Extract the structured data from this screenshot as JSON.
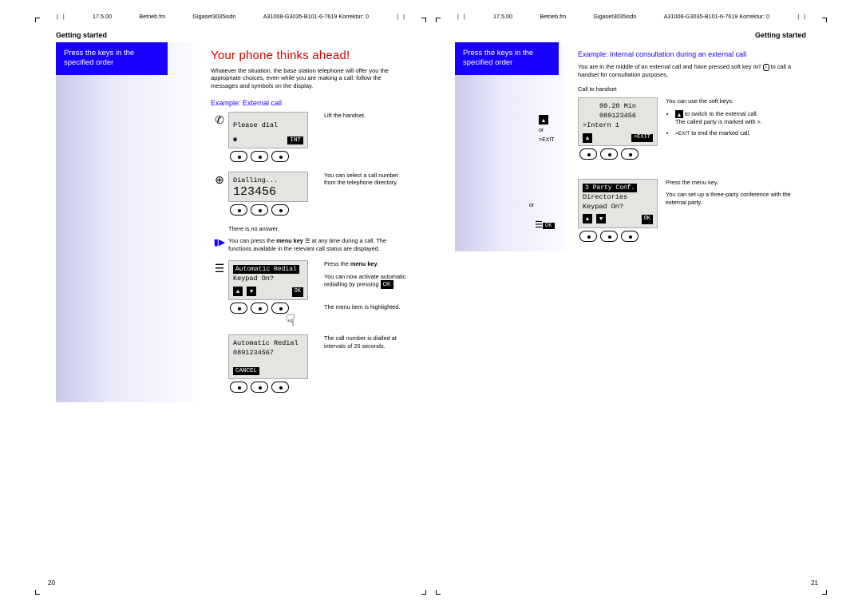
{
  "meta": {
    "left": {
      "a": "17.5.00",
      "b": "Betrieb.fm",
      "c": "Gigaset3035isdn",
      "d": "A31008-G3035-B101-6-7619  Korrektur: 0"
    },
    "right": {
      "a": "17.5.00",
      "b": "Betrieb.fm",
      "c": "Gigaset3035isdn",
      "d": "A31008-G3035-B101-6-7619  Korrektur: 0"
    }
  },
  "header": {
    "left": "Getting started",
    "right": "Getting started"
  },
  "blue_box": "Press the keys in the specified order",
  "pages": {
    "left_num": "20",
    "right_num": "21"
  },
  "left": {
    "h1": "Your phone thinks ahead!",
    "intro": "Whatever the situation, the base station telephone will offer you the appropriate choices, even while you are making a call: follow the messages and symbols on the display.",
    "ex_title": "Example: External call",
    "scr1_line": "Please dial",
    "scr1_int": "INT",
    "step1_desc": "Lift the handset.",
    "scr2_l1": "Dialling...",
    "scr2_l2": "123456",
    "step2_desc": "You can select a call number from the telephone directory.",
    "no_answer": "There is no answer.",
    "note": "You can press the menu key ☰ at any time during a call. The functions available in the relevant call status are displayed.",
    "note_bold": "menu key",
    "scr3_l1": "Automatic Redial",
    "scr3_l2": "Keypad On?",
    "step3_a": "Press the",
    "step3_b": "menu key",
    "step3_c": "You can now activate automatic redialling by pressing",
    "step3_d": "The menu item is highlighted.",
    "scr4_l1": "Automatic Redial",
    "scr4_l2": "0891234567",
    "scr4_btn": "CANCEL",
    "step4": "The call number is dialled at intervals of 20 seconds."
  },
  "right": {
    "ex_title": "Example: Internal consultation during an external call",
    "intro_a": "You are in the middle of an external call and have pressed soft key",
    "intro_b": "to call a handset for consultation purposes.",
    "call_to": "Call to handset",
    "or": "or",
    "exit": ">EXIT",
    "scrR1_a": "00.20 Min",
    "scrR1_b": "089123456",
    "scrR1_c": ">Intern 1",
    "scrR1_d": ">EXIT",
    "right_desc": "You can use the soft keys:",
    "b1a": "to switch to the external call.",
    "b1b": "The called party is marked with >.",
    "b2": "to end the marked call.",
    "or2": "or",
    "scrR2_a": "3 Party Conf.",
    "scrR2_b": "Directories",
    "scrR2_c": "Keypad On?",
    "r2a": "Press the menu key.",
    "r2b": "You can set up a three-party conference with the external party."
  }
}
